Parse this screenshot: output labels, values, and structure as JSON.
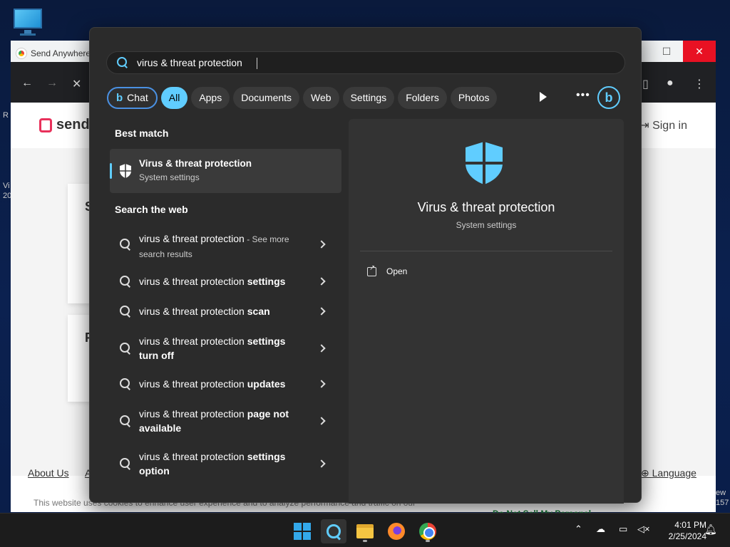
{
  "browser": {
    "tab_title": "Send Anywhere",
    "logo_text": "senda",
    "sign_in": "Sign in",
    "footer_links": [
      "About Us",
      "A"
    ],
    "language": "Language",
    "cookie_text": "This website uses cookies to enhance user experience and to analyze performance and traffic on our",
    "do_not_sell": "Do Not Sell My Personal",
    "card_letters": [
      "S",
      "F"
    ],
    "right_scraps": [
      "ew",
      "157"
    ],
    "left_scraps": [
      "R",
      "Vi",
      "20"
    ]
  },
  "search": {
    "query": "virus & threat protection",
    "filters": [
      "Chat",
      "All",
      "Apps",
      "Documents",
      "Web",
      "Settings",
      "Folders",
      "Photos"
    ],
    "active_filter": "All",
    "best_match_heading": "Best match",
    "best_match": {
      "title": "Virus & threat protection",
      "subtitle": "System settings",
      "icon": "shield-icon"
    },
    "web_heading": "Search the web",
    "web_results": [
      {
        "prefix": "virus & threat protection",
        "bold": "",
        "suffix": " - See more search results"
      },
      {
        "prefix": "virus & threat protection ",
        "bold": "settings",
        "suffix": ""
      },
      {
        "prefix": "virus & threat protection ",
        "bold": "scan",
        "suffix": ""
      },
      {
        "prefix": "virus & threat protection ",
        "bold": "settings turn off",
        "suffix": ""
      },
      {
        "prefix": "virus & threat protection ",
        "bold": "updates",
        "suffix": ""
      },
      {
        "prefix": "virus & threat protection ",
        "bold": "page not available",
        "suffix": ""
      },
      {
        "prefix": "virus & threat protection ",
        "bold": "settings option",
        "suffix": ""
      }
    ],
    "preview": {
      "title": "Virus & threat protection",
      "subtitle": "System settings",
      "action": "Open"
    }
  },
  "taskbar": {
    "apps": [
      "start-icon",
      "search-icon",
      "file-explorer-icon",
      "firefox-icon",
      "chrome-icon"
    ],
    "time": "4:01 PM",
    "date": "2/25/2024"
  },
  "colors": {
    "accent": "#60cdff",
    "panel_bg": "#2b2b2b",
    "preview_bg": "#333333"
  }
}
